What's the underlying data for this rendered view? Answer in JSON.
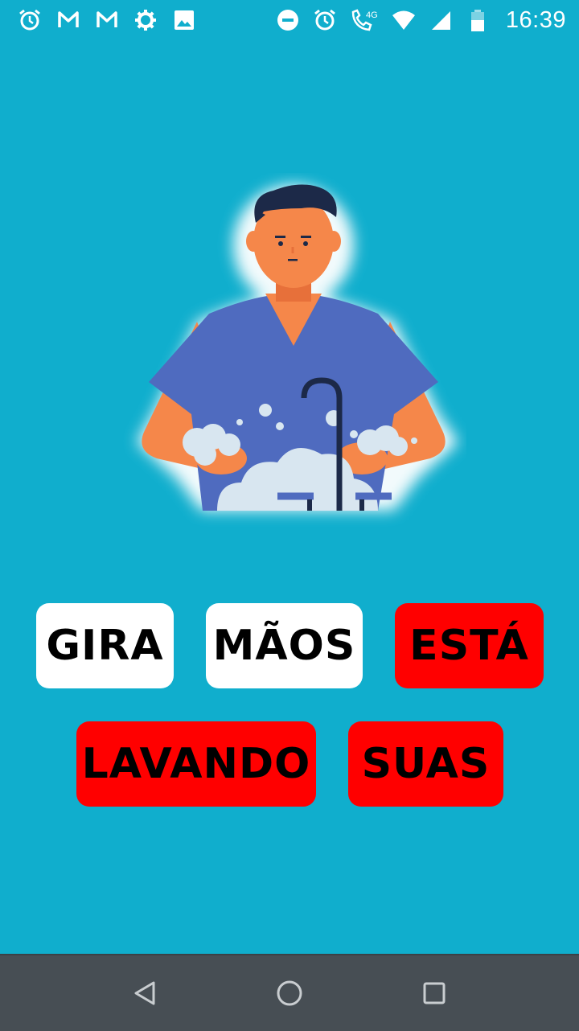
{
  "status_bar": {
    "time": "16:39",
    "network": "4G",
    "left_icons": [
      "alarm-icon",
      "gmail-icon",
      "gmail-icon",
      "settings-icon",
      "gallery-icon"
    ],
    "right_icons": [
      "do-not-disturb-icon",
      "alarm-icon",
      "volte-call-icon",
      "wifi-icon",
      "signal-icon",
      "battery-icon"
    ]
  },
  "illustration": {
    "subject": "man-washing-hands-illustration"
  },
  "word_tiles": [
    {
      "text": "GIRA",
      "state": "unselected",
      "color": "#ffffff"
    },
    {
      "text": "MÃOS",
      "state": "unselected",
      "color": "#ffffff"
    },
    {
      "text": "ESTÁ",
      "state": "selected",
      "color": "#ff0000"
    },
    {
      "text": "LAVANDO",
      "state": "selected",
      "color": "#ff0000"
    },
    {
      "text": "SUAS",
      "state": "selected",
      "color": "#ff0000"
    }
  ],
  "nav_bar": {
    "buttons": [
      "back-icon",
      "home-icon",
      "recents-icon"
    ]
  },
  "colors": {
    "background": "#10aecd",
    "tile_white": "#ffffff",
    "tile_red": "#ff0000",
    "nav_bar": "#474e54"
  }
}
